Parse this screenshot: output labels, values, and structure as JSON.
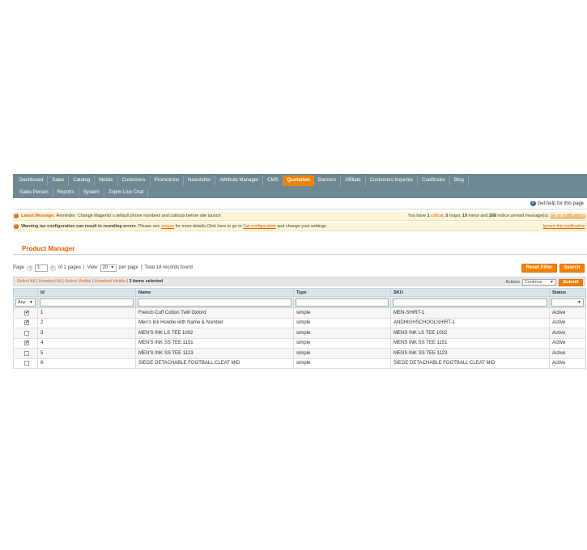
{
  "nav": {
    "row1": [
      "Dashboard",
      "Sales",
      "Catalog",
      "Mobile",
      "Customers",
      "Promotions",
      "Newsletter",
      "Attribute Manager",
      "CMS",
      "Quotation",
      "Banners",
      "Affiliate",
      "Customers Inquiries",
      "CueBlocks",
      "Blog"
    ],
    "row2": [
      "Sales Person",
      "Reports",
      "System",
      "Zopim Live Chat"
    ],
    "active": "Quotation"
  },
  "help": {
    "label": "Get help for this page"
  },
  "messages": {
    "latest_label": "Latest Message:",
    "latest_text": "Reminder: Change Magento`s default phone numbers and callouts before site launch",
    "summary_prefix": "You have",
    "critical_count": "1",
    "critical_label": "critical",
    "major_count": "5",
    "major_label": "major,",
    "minor_count": "19",
    "minor_label": "minor and",
    "notice_count": "268",
    "notice_label": "notice unread message(s).",
    "goto_link": "Go to notifications",
    "warning_bold": "Warning tax configuration can result in rounding errors",
    "warning_pre": ". Please see",
    "warning_source": "source",
    "warning_mid": "for more details.Click here to go to",
    "warning_taxlink": "Tax configuration",
    "warning_post": "and change your settings.",
    "ignore_link": "Ignore this notification"
  },
  "page_title": "Product Manager",
  "pager": {
    "page_label": "Page",
    "page_value": "1",
    "of_pages": "of 1 pages",
    "view_label": "View",
    "per_page_value": "20",
    "per_page_label": "per page",
    "records": "Total 18 records found"
  },
  "buttons": {
    "reset": "Reset Filter",
    "search": "Search",
    "submit": "Submit"
  },
  "massaction": {
    "select_all": "Select All",
    "unselect_all": "Unselect All",
    "select_visible": "Select Visible",
    "unselect_visible": "Unselect Visible",
    "selected": "3 items selected",
    "actions_label": "Actions",
    "actions_value": "Continue"
  },
  "grid": {
    "headers": {
      "id": "Id",
      "name": "Name",
      "type": "Type",
      "sku": "SKU",
      "status": "Status"
    },
    "filter_any": "Any",
    "rows": [
      {
        "checked": true,
        "id": "1",
        "name": "French Cuff Cotton Twill Oxford",
        "type": "simple",
        "sku": "MEN-SHIRT-1",
        "status": "Active"
      },
      {
        "checked": true,
        "id": "2",
        "name": "Men's Ink Hoodie with Name & Number",
        "type": "simple",
        "sku": "ANDHIGHSCHOOLSHIRT-1",
        "status": "Active"
      },
      {
        "checked": false,
        "id": "3",
        "name": "MEN'S INK LS TEE 1002",
        "type": "simple",
        "sku": "MENS INK LS TEE 1002",
        "status": "Active"
      },
      {
        "checked": true,
        "id": "4",
        "name": "MEN'S INK SS TEE 1151",
        "type": "simple",
        "sku": "MENS INK SS TEE 1151",
        "status": "Active"
      },
      {
        "checked": false,
        "id": "5",
        "name": "MEN'S INK SS TEE 1123",
        "type": "simple",
        "sku": "MENS INK SS TEE 1123",
        "status": "Active"
      },
      {
        "checked": false,
        "id": "6",
        "name": "SIEGE DETACHABLE FOOTBALL CLEAT MID",
        "type": "simple",
        "sku": "SIEGE DETACHABLE FOOTBALL CLEAT MID",
        "status": "Active"
      }
    ]
  }
}
